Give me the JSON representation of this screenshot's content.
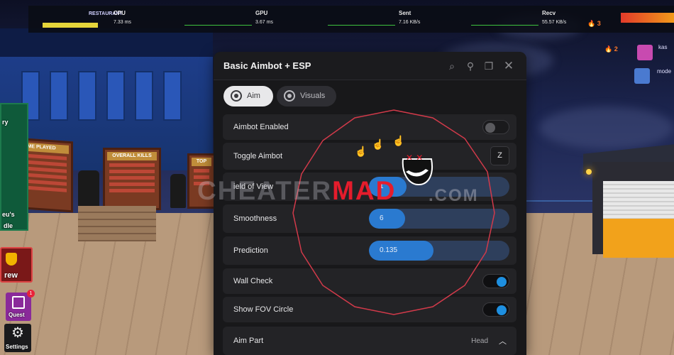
{
  "stats": {
    "cpu": {
      "name": "CPU",
      "value": "7.33 ms"
    },
    "gpu": {
      "name": "GPU",
      "value": "3.67 ms"
    },
    "sent": {
      "name": "Sent",
      "value": "7.16 KB/s"
    },
    "recv": {
      "name": "Recv",
      "value": "55.57 KB/s"
    },
    "logo_text": "RESTAURANT"
  },
  "streaks": {
    "first": "3",
    "second": "2"
  },
  "players": [
    {
      "name": "kas"
    },
    {
      "name": "mode"
    }
  ],
  "leaderboards": {
    "time_played": "TIME PLAYED",
    "overall_kills": "OVERALL KILLS",
    "top": "TOP"
  },
  "hud": {
    "crew_label": "rew",
    "quest_label": "Quest",
    "quest_badge": "1",
    "settings_label": "Settings",
    "left_text_1": "ry",
    "left_text_2": "eu's",
    "left_text_3": "dle"
  },
  "panel": {
    "title": "Basic Aimbot + ESP",
    "tabs": [
      {
        "label": "Aim",
        "active": true
      },
      {
        "label": "Visuals",
        "active": false
      }
    ],
    "rows": {
      "aimbot_enabled": {
        "label": "Aimbot Enabled",
        "on": false
      },
      "toggle_aimbot": {
        "label": "Toggle Aimbot",
        "key": "Z"
      },
      "fov": {
        "label": "ield of View",
        "value": "1",
        "level": 0.27
      },
      "smoothness": {
        "label": "Smoothness",
        "value": "6",
        "level": 0.26
      },
      "prediction": {
        "label": "Prediction",
        "value": "0.135",
        "level": 0.46
      },
      "wall_check": {
        "label": "Wall Check",
        "on": true
      },
      "show_fov": {
        "label": "Show FOV Circle",
        "on": true
      },
      "aim_part": {
        "label": "Aim Part",
        "value": "Head"
      }
    }
  },
  "watermark": {
    "part1": "CHEATER",
    "part2": "MAD",
    "part3": ".COM"
  },
  "colors": {
    "accent": "#1e8fe0",
    "fov_ring": "#d23a4a",
    "watermark_red": "#e51c2c"
  }
}
